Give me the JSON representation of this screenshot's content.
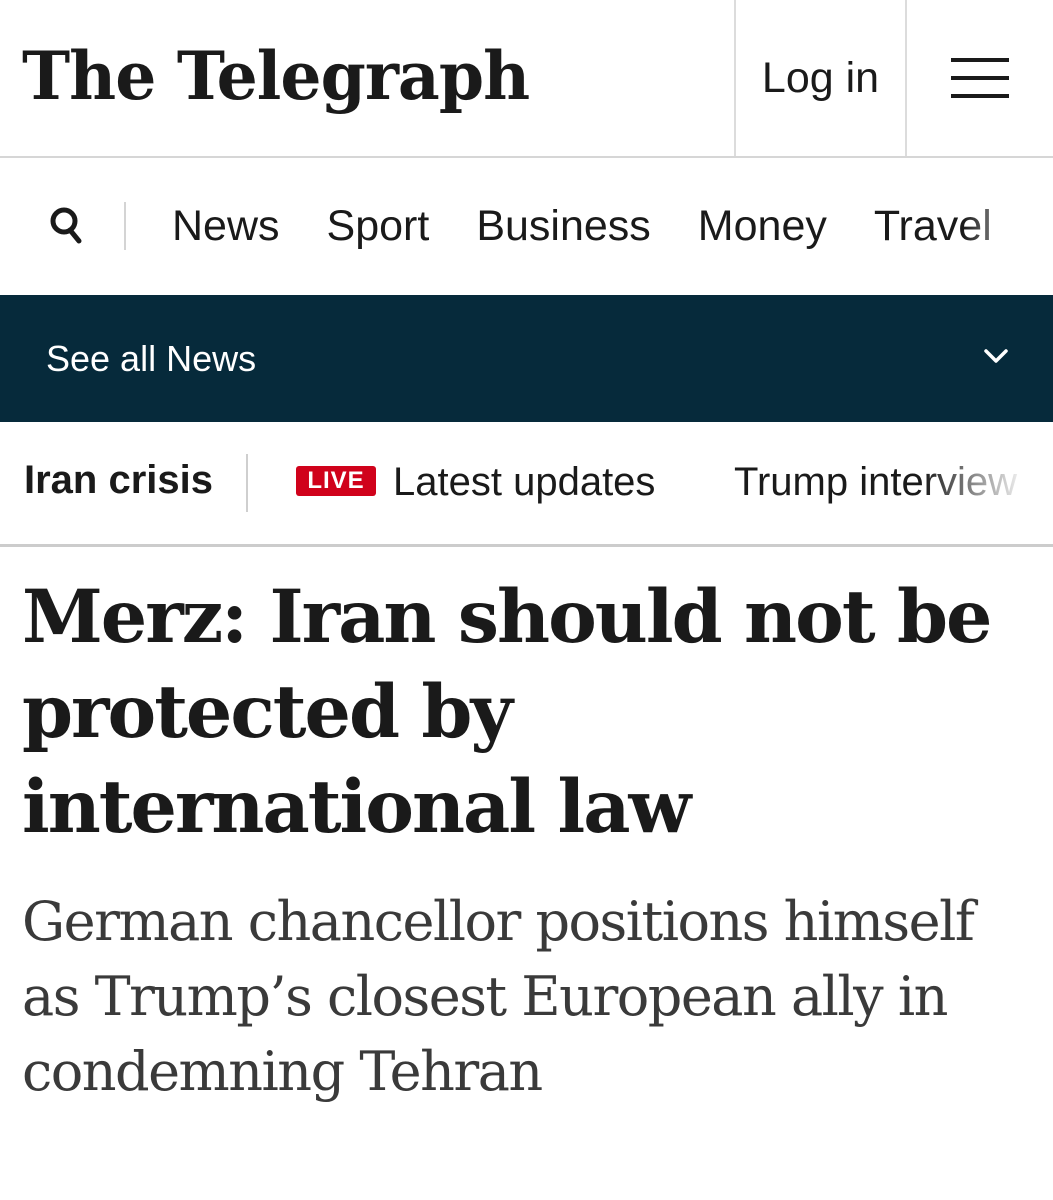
{
  "masthead": {
    "logo_text": "The Telegraph",
    "login_label": "Log in",
    "menu_icon": "hamburger-menu-icon",
    "search_icon": "search-icon"
  },
  "nav": {
    "items": [
      "News",
      "Sport",
      "Business",
      "Money",
      "Travel"
    ]
  },
  "section_bar": {
    "label": "See all News",
    "chevron_icon": "chevron-down-icon",
    "background_color": "#062a3b"
  },
  "topic_strip": {
    "main_topic": "Iran crisis",
    "live_badge": "LIVE",
    "live_color": "#d0021b",
    "links": [
      "Latest updates",
      "Trump interview"
    ]
  },
  "article": {
    "headline": "Merz: Iran should not be protected by international law",
    "standfirst": "German chancellor positions himself as Trump’s closest European ally in condemning Tehran"
  }
}
